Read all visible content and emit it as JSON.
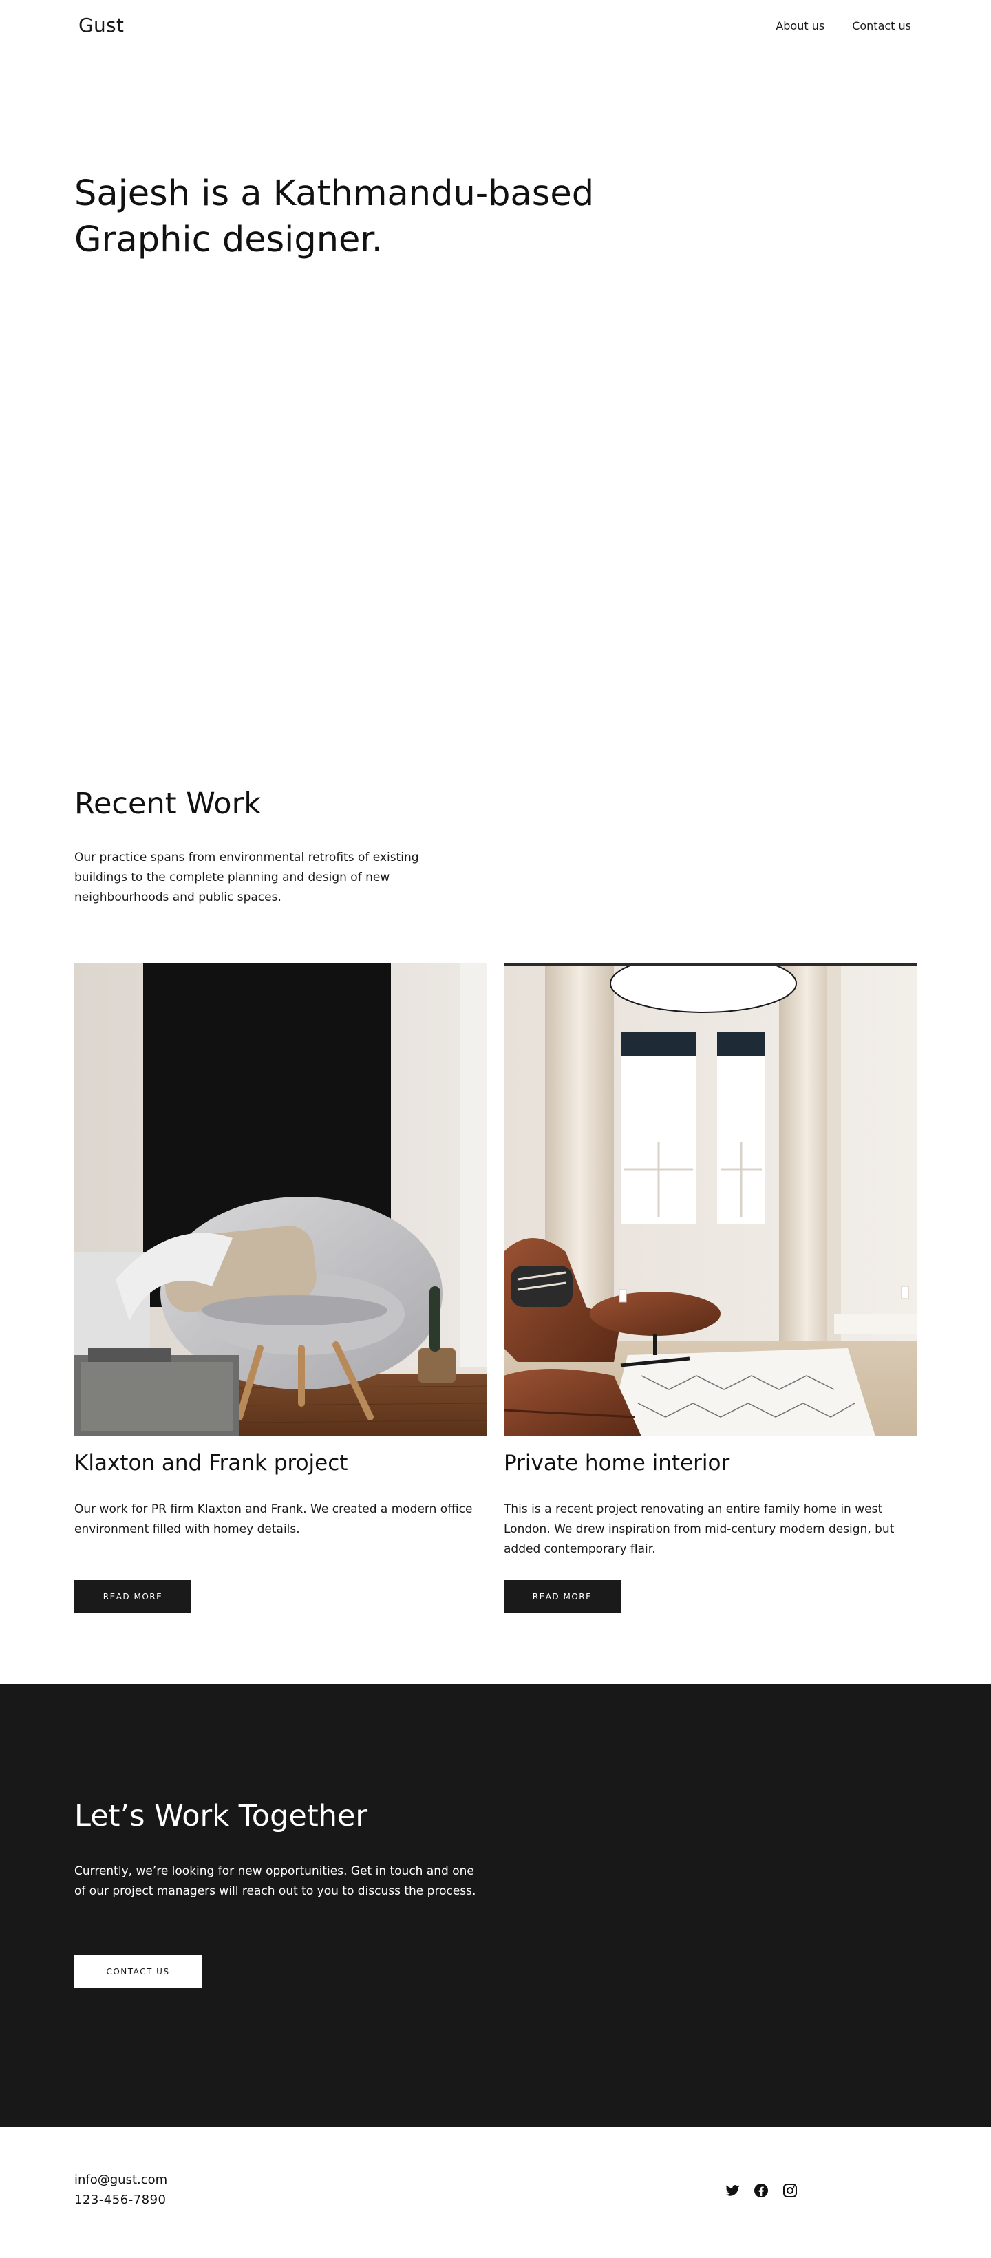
{
  "header": {
    "brand": "Gust",
    "nav": [
      "About us",
      "Contact us"
    ]
  },
  "hero": {
    "title_line1": "Sajesh is a Kathmandu-based",
    "title_line2": "Graphic designer."
  },
  "recent_work": {
    "title": "Recent Work",
    "description": "Our practice spans from environmental retrofits of existing buildings to the complete planning and design of new neighbourhoods and public spaces.",
    "projects": [
      {
        "title": "Klaxton and Frank project",
        "description": "Our work for PR firm Klaxton and Frank. We created a modern office environment filled with homey details.",
        "button": "READ MORE"
      },
      {
        "title": "Private home interior",
        "description": "This is a recent project renovating an entire family home in west London. We drew inspiration from mid-century modern design, but added contemporary flair.",
        "button": "READ MORE"
      }
    ]
  },
  "cta": {
    "title": "Let’s Work Together",
    "description": "Currently, we’re looking for new opportunities. Get in touch and one of our project managers will reach out to you to discuss the process.",
    "button": "CONTACT US"
  },
  "footer": {
    "email": "info@gust.com",
    "phone": "123-456-7890",
    "socials": [
      "twitter-icon",
      "facebook-icon",
      "instagram-icon"
    ]
  },
  "colors": {
    "dark": "#181818",
    "button_dark": "#1a1a1a",
    "text": "#111111",
    "background": "#ffffff"
  }
}
